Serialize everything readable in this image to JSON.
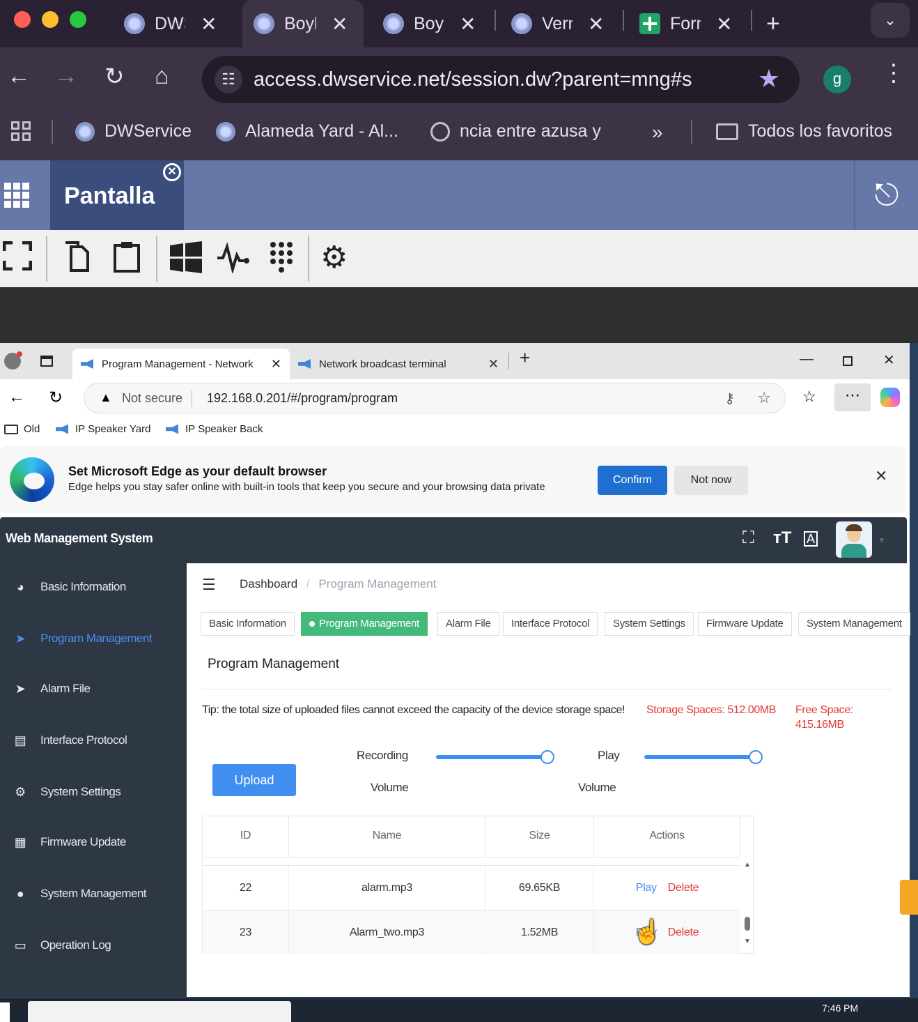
{
  "chrome": {
    "tabs": [
      {
        "title": "DWService",
        "favicon": "dwservice-icon"
      },
      {
        "title": "Boyle",
        "favicon": "dwservice-icon",
        "active": true
      },
      {
        "title": "Boyle",
        "favicon": "dwservice-icon"
      },
      {
        "title": "Vernon",
        "favicon": "dwservice-icon"
      },
      {
        "title": "Form",
        "favicon": "sheets-icon"
      }
    ],
    "url": "access.dwservice.net/session.dw?parent=mng#s",
    "profile_initial": "g",
    "bookmarks": [
      {
        "label": "DWService"
      },
      {
        "label": "Alameda Yard - Al..."
      },
      {
        "label": "ncia entre azusa y"
      }
    ],
    "all_bookmarks_label": "Todos los favoritos"
  },
  "dwservice": {
    "session_tab": "Pantalla"
  },
  "edge": {
    "tabs": [
      {
        "title": "Program Management - Network",
        "active": true
      },
      {
        "title": "Network broadcast terminal"
      }
    ],
    "security_label": "Not secure",
    "url": "192.168.0.201/#/program/program",
    "bookmarks": [
      {
        "label": "Old"
      },
      {
        "label": "IP Speaker Yard"
      },
      {
        "label": "IP Speaker Back"
      }
    ],
    "banner": {
      "title": "Set Microsoft Edge as your default browser",
      "subtitle": "Edge helps you stay safer online with built-in tools that keep you secure and your browsing data private",
      "confirm": "Confirm",
      "not_now": "Not now"
    }
  },
  "app": {
    "title": "Web Management System",
    "sidebar": [
      {
        "label": "Basic Information",
        "icon": "dashboard-icon"
      },
      {
        "label": "Program Management",
        "icon": "send-icon",
        "active": true
      },
      {
        "label": "Alarm File",
        "icon": "send-icon"
      },
      {
        "label": "Interface Protocol",
        "icon": "document-icon"
      },
      {
        "label": "System Settings",
        "icon": "gear-icon"
      },
      {
        "label": "Firmware Update",
        "icon": "grid-icon"
      },
      {
        "label": "System Management",
        "icon": "globe-icon"
      },
      {
        "label": "Operation Log",
        "icon": "log-icon"
      }
    ],
    "breadcrumb": {
      "root": "Dashboard",
      "current": "Program Management"
    },
    "tabs": [
      {
        "label": "Basic Information"
      },
      {
        "label": "Program Management",
        "active": true
      },
      {
        "label": "Alarm File"
      },
      {
        "label": "Interface Protocol"
      },
      {
        "label": "System Settings"
      },
      {
        "label": "Firmware Update"
      },
      {
        "label": "System Management"
      }
    ],
    "page_title": "Program Management",
    "tip": "Tip: the total size of uploaded files cannot exceed the capacity of the device storage space!",
    "storage": "Storage Spaces: 512.00MB",
    "free_space": "Free Space: 415.16MB",
    "upload": "Upload",
    "recording_volume": {
      "label_top": "Recording",
      "label_bottom": "Volume",
      "value": 100
    },
    "play_volume": {
      "label_top": "Play",
      "label_bottom": "Volume",
      "value": 100
    },
    "table": {
      "headers": [
        "ID",
        "Name",
        "Size",
        "Actions"
      ],
      "rows": [
        {
          "id": "22",
          "name": "alarm.mp3",
          "size": "69.65KB"
        },
        {
          "id": "23",
          "name": "Alarm_two.mp3",
          "size": "1.52MB"
        }
      ],
      "play": "Play",
      "delete": "Delete"
    }
  },
  "taskbar": {
    "time": "7:46 PM"
  }
}
